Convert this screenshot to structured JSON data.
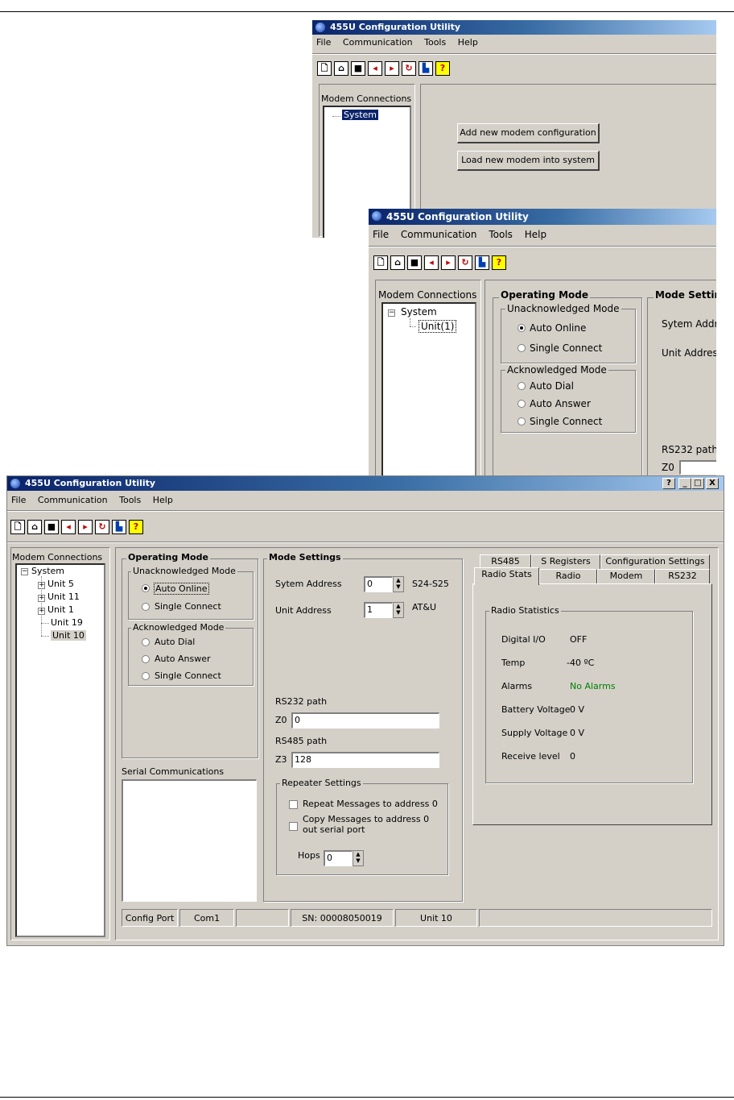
{
  "app_title": "455U Configuration Utility",
  "menu": [
    "File",
    "Communication",
    "Tools",
    "Help"
  ],
  "toolbar_icons": [
    "new-file-icon",
    "open-folder-icon",
    "save-disk-icon",
    "read-modem-icon",
    "write-modem-icon",
    "reset-icon",
    "chart-icon",
    "help-icon"
  ],
  "window1": {
    "tree_title": "Modem Connections",
    "tree_items": [
      "System"
    ],
    "buttons": [
      "Add new modem configuration",
      "Load new modem into system"
    ]
  },
  "window2": {
    "tree_title": "Modem Connections",
    "tree_items": [
      "System",
      "Unit(1)"
    ],
    "operating_mode": "Operating Mode",
    "unack_mode": "Unacknowledged Mode",
    "unack_options": [
      "Auto Online",
      "Single Connect"
    ],
    "ack_mode": "Acknowledged Mode",
    "ack_options": [
      "Auto Dial",
      "Auto Answer",
      "Single Connect"
    ],
    "mode_settings": "Mode Settin",
    "system_address": "Sytem Addre",
    "unit_address": "Unit Address",
    "rs232_path": "RS232 path",
    "z0": "Z0"
  },
  "window3": {
    "window_controls": [
      "?",
      "_",
      "□",
      "X"
    ],
    "tree_title": "Modem Connections",
    "tree_root": "System",
    "tree_items": [
      {
        "label": "Unit 5",
        "expandable": true
      },
      {
        "label": "Unit 11",
        "expandable": true
      },
      {
        "label": "Unit 1",
        "expandable": true
      },
      {
        "label": "Unit 19",
        "expandable": false
      },
      {
        "label": "Unit 10",
        "expandable": false,
        "selected": true
      }
    ],
    "operating_mode": {
      "title": "Operating Mode",
      "unack_title": "Unacknowledged Mode",
      "unack_options": [
        "Auto Online",
        "Single Connect"
      ],
      "ack_title": "Acknowledged Mode",
      "ack_options": [
        "Auto Dial",
        "Auto Answer",
        "Single Connect"
      ]
    },
    "serial_comm_label": "Serial Communications",
    "mode_settings": {
      "title": "Mode Settings",
      "system_address_label": "Sytem Address",
      "system_address_value": "0",
      "system_address_reg": "S24-S25",
      "unit_address_label": "Unit Address",
      "unit_address_value": "1",
      "unit_address_reg": "AT&U",
      "rs232_label": "RS232 path",
      "z0_label": "Z0",
      "z0_value": "0",
      "rs485_label": "RS485 path",
      "z3_label": "Z3",
      "z3_value": "128",
      "repeater_title": "Repeater Settings",
      "repeat_label": "Repeat Messages to address 0",
      "copy_label_1": "Copy Messages to address 0",
      "copy_label_2": "out serial port",
      "hops_label": "Hops",
      "hops_value": "0"
    },
    "tabs_back": [
      "RS485",
      "S Registers",
      "Configuration Settings"
    ],
    "tabs_front": [
      "Radio Stats",
      "Radio",
      "Modem",
      "RS232"
    ],
    "radio_stats": {
      "title": "Radio Statistics",
      "rows": [
        {
          "label": "Digital I/O",
          "value": "OFF"
        },
        {
          "label": "Temp",
          "value": "-40 ºC"
        },
        {
          "label": "Alarms",
          "value": "No Alarms"
        },
        {
          "label": "Battery Voltage",
          "value": "0 V"
        },
        {
          "label": "Supply Voltage",
          "value": "0 V"
        },
        {
          "label": "Receive level",
          "value": "0"
        }
      ],
      "alarm_color": "#008000"
    },
    "status_bar": [
      "Config Port",
      "Com1",
      "",
      "SN: 00008050019",
      "Unit 10",
      ""
    ]
  }
}
